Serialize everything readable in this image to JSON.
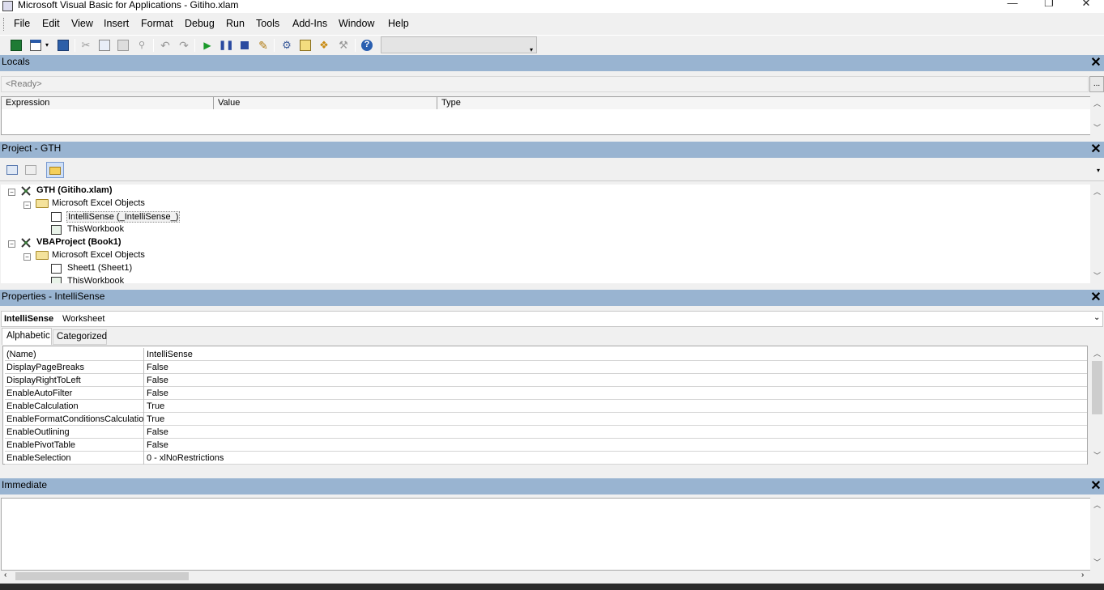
{
  "window": {
    "title": "Microsoft Visual Basic for Applications - Gitiho.xlam",
    "minimize": "—",
    "maximize": "❐",
    "close": "✕"
  },
  "menu": [
    "File",
    "Edit",
    "View",
    "Insert",
    "Format",
    "Debug",
    "Run",
    "Tools",
    "Add-Ins",
    "Window",
    "Help"
  ],
  "toolbar": {
    "icons": [
      "view-excel-icon",
      "insert-userform-icon",
      "save-icon",
      "cut-icon",
      "copy-icon",
      "paste-icon",
      "find-icon",
      "undo-icon",
      "redo-icon",
      "run-icon",
      "break-icon",
      "reset-icon",
      "design-mode-icon",
      "project-explorer-icon",
      "properties-window-icon",
      "object-browser-icon",
      "toolbox-icon",
      "help-icon"
    ],
    "position_combo": ""
  },
  "locals": {
    "title": "Locals",
    "status": "<Ready>",
    "more": "...",
    "columns": [
      "Expression",
      "Value",
      "Type"
    ]
  },
  "project": {
    "title": "Project - GTH",
    "tree": [
      {
        "text": "GTH (Gitiho.xlam)",
        "bold": true
      },
      {
        "text": "Microsoft Excel Objects"
      },
      {
        "text": "IntelliSense (_IntelliSense_)"
      },
      {
        "text": "ThisWorkbook"
      },
      {
        "text": "VBAProject (Book1)",
        "bold": true
      },
      {
        "text": "Microsoft Excel Objects"
      },
      {
        "text": "Sheet1 (Sheet1)"
      },
      {
        "text": "ThisWorkbook"
      }
    ]
  },
  "properties": {
    "title": "Properties - IntelliSense",
    "object_name": "IntelliSense",
    "object_type": "Worksheet",
    "tabs": [
      "Alphabetic",
      "Categorized"
    ],
    "rows": [
      {
        "name": "(Name)",
        "value": "IntelliSense"
      },
      {
        "name": "DisplayPageBreaks",
        "value": "False"
      },
      {
        "name": "DisplayRightToLeft",
        "value": "False"
      },
      {
        "name": "EnableAutoFilter",
        "value": "False"
      },
      {
        "name": "EnableCalculation",
        "value": "True"
      },
      {
        "name": "EnableFormatConditionsCalculation",
        "value": "True"
      },
      {
        "name": "EnableOutlining",
        "value": "False"
      },
      {
        "name": "EnablePivotTable",
        "value": "False"
      },
      {
        "name": "EnableSelection",
        "value": "0 - xlNoRestrictions"
      }
    ]
  },
  "immediate": {
    "title": "Immediate",
    "content": ""
  },
  "colors": {
    "pane_header": "#99b4d1",
    "window_bg": "#f0f0f0"
  }
}
